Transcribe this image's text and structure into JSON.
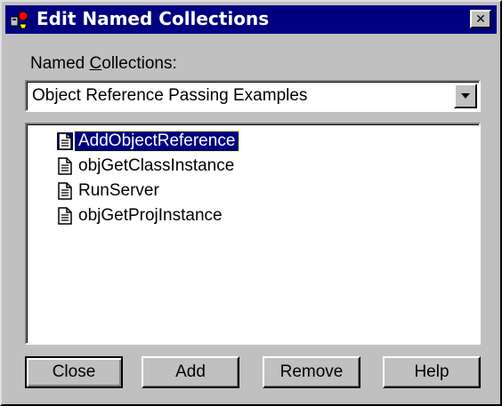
{
  "window": {
    "title": "Edit Named Collections",
    "app_icon": "collection-app-icon",
    "close_glyph": "✕"
  },
  "collections": {
    "label_prefix": "Named ",
    "label_accel": "C",
    "label_suffix": "ollections:",
    "selected_value": "Object Reference Passing Examples",
    "dropdown_icon": "chevron-down-icon"
  },
  "items": [
    {
      "label": "AddObjectReference",
      "icon": "document-icon",
      "selected": true
    },
    {
      "label": "objGetClassInstance",
      "icon": "document-icon",
      "selected": false
    },
    {
      "label": "RunServer",
      "icon": "document-icon",
      "selected": false
    },
    {
      "label": "objGetProjInstance",
      "icon": "document-icon",
      "selected": false
    }
  ],
  "buttons": {
    "close": "Close",
    "add": "Add",
    "remove": "Remove",
    "help": "Help"
  },
  "colors": {
    "titlebar": "#000080",
    "face": "#c0c0c0",
    "selection": "#000080"
  }
}
